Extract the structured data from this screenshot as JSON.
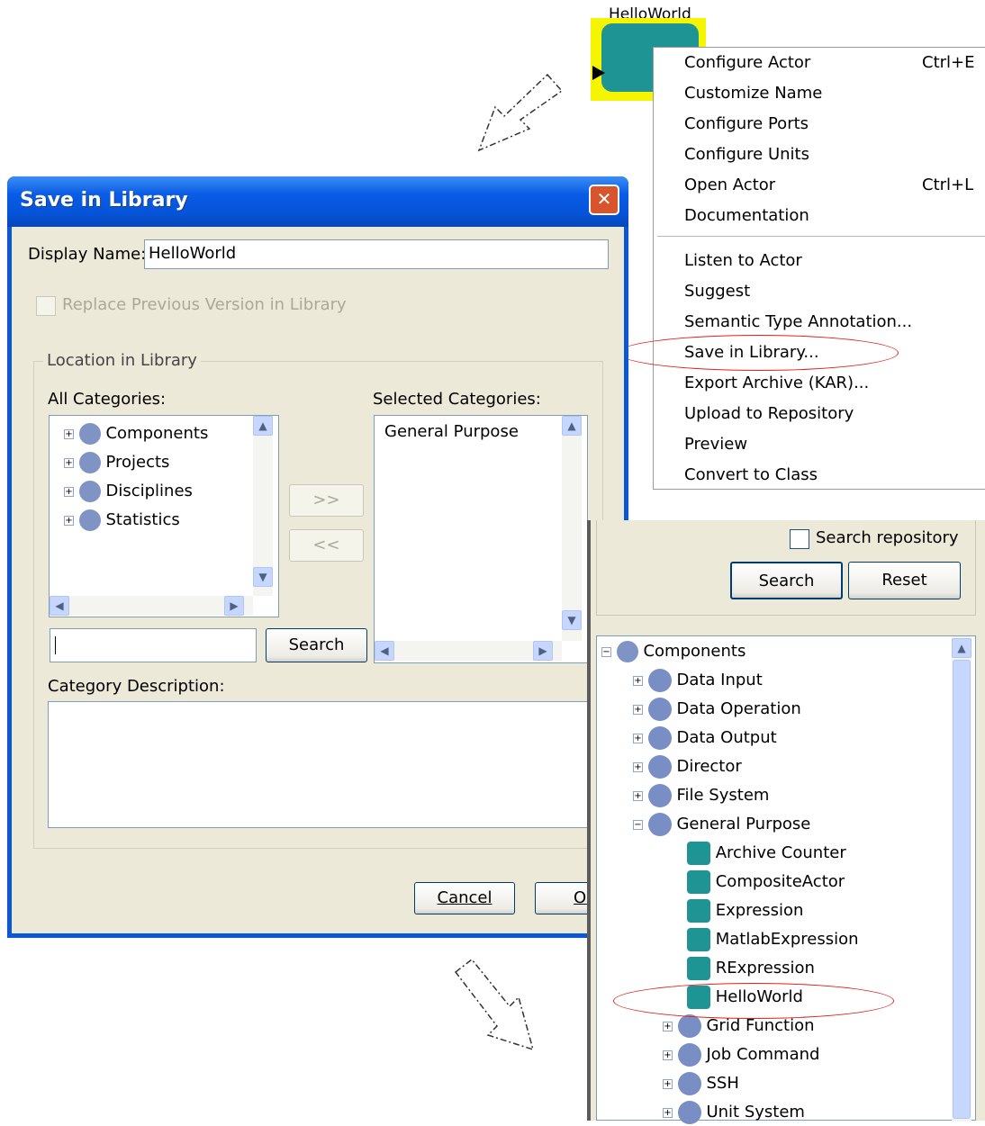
{
  "actor": {
    "name": "HelloWorld"
  },
  "context_menu": {
    "items": [
      {
        "label": "Configure Actor",
        "shortcut": "Ctrl+E"
      },
      {
        "label": "Customize Name"
      },
      {
        "label": "Configure Ports"
      },
      {
        "label": "Configure Units"
      },
      {
        "label": "Open Actor",
        "shortcut": "Ctrl+L"
      },
      {
        "label": "Documentation",
        "submenu": "▶"
      },
      {
        "label": "Listen to Actor"
      },
      {
        "label": "Suggest",
        "submenu": "▶"
      },
      {
        "label": "Semantic Type Annotation..."
      },
      {
        "label": "Save in Library..."
      },
      {
        "label": "Export Archive (KAR)..."
      },
      {
        "label": "Upload to Repository"
      },
      {
        "label": "Preview"
      },
      {
        "label": "Convert to Class"
      }
    ]
  },
  "dialog": {
    "title": "Save in Library",
    "close_glyph": "✕",
    "display_name_label": "Display Name:",
    "display_name_value": "HelloWorld",
    "replace_label": "Replace Previous Version in Library",
    "location_group": "Location in Library",
    "all_categories_label": "All Categories:",
    "all_categories": [
      "Components",
      "Projects",
      "Disciplines",
      "Statistics"
    ],
    "selected_categories_label": "Selected Categories:",
    "selected_categories": [
      "General Purpose"
    ],
    "add_button": ">>",
    "remove_button": "<<",
    "search_button": "Search",
    "search_value": "",
    "category_description_label": "Category Description:",
    "cancel_button": "Cancel",
    "ok_button": "OK"
  },
  "library_panel": {
    "search_repository_label": "Search repository",
    "search_button": "Search",
    "reset_button": "Reset",
    "tree": {
      "root": "Components",
      "groups": [
        "Data Input",
        "Data Operation",
        "Data Output",
        "Director",
        "File System",
        "General Purpose"
      ],
      "general_purpose_items": [
        "Archive Counter",
        "CompositeActor",
        "Expression",
        "MatlabExpression",
        "RExpression",
        "HelloWorld"
      ],
      "other_groups": [
        "Grid Function",
        "Job Command",
        "SSH",
        "Unit System"
      ]
    }
  },
  "icons": {
    "plus": "+",
    "minus": "−",
    "up": "▲",
    "down": "▼",
    "left": "◀",
    "right": "▶"
  }
}
